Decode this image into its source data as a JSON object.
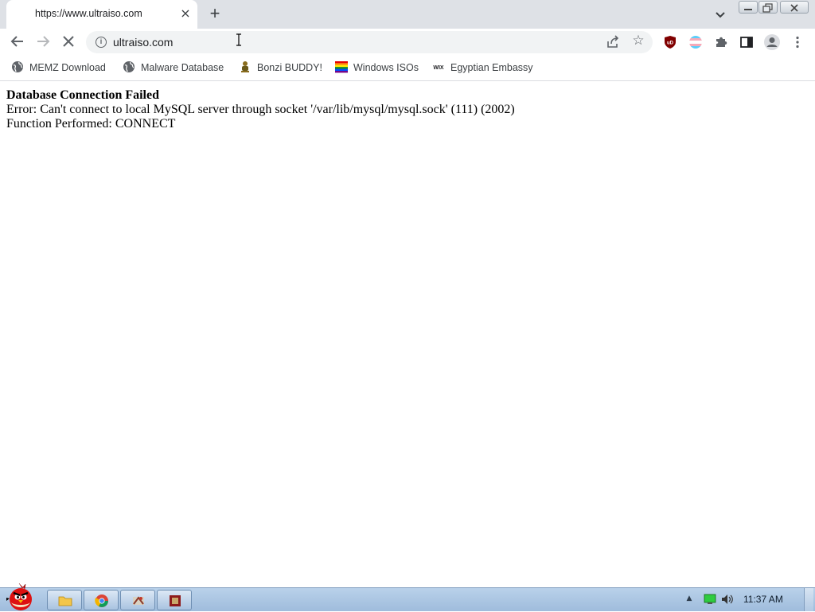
{
  "tab": {
    "title": "https://www.ultraiso.com",
    "close_label": "×",
    "new_tab_label": "+"
  },
  "omnibox": {
    "url": "ultraiso.com"
  },
  "bookmarks": [
    {
      "label": "MEMZ Download",
      "icon": "globe-icon"
    },
    {
      "label": "Malware Database",
      "icon": "globe-icon"
    },
    {
      "label": "Bonzi BUDDY!",
      "icon": "bonzi-icon"
    },
    {
      "label": "Windows ISOs",
      "icon": "rainbow-flag-icon"
    },
    {
      "label": "Egyptian Embassy",
      "icon": "wix-icon"
    }
  ],
  "page": {
    "title": "Database Connection Failed",
    "error": "Error: Can't connect to local MySQL server through socket '/var/lib/mysql/mysql.sock' (111) (2002)",
    "function": "Function Performed: CONNECT"
  },
  "taskbar": {
    "clock": "11:37 AM"
  },
  "colors": {
    "tabstrip": "#dee1e6",
    "omnibox": "#f1f3f4",
    "taskbar": "#b9d1ea",
    "ublock": "#800000"
  }
}
